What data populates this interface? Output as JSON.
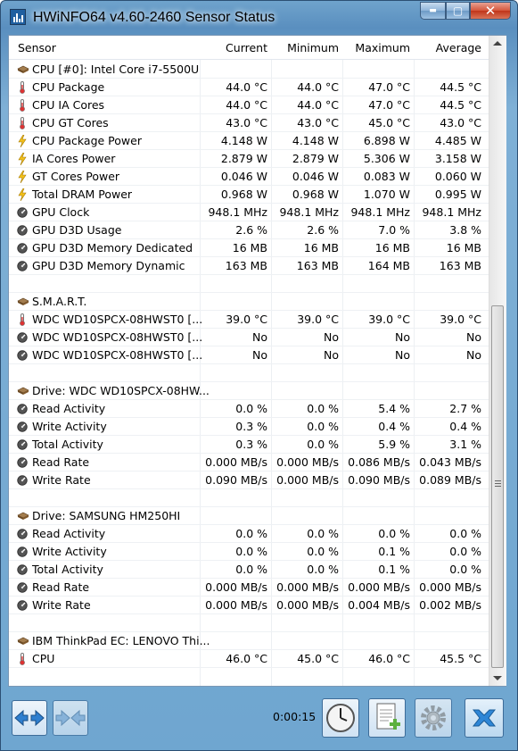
{
  "window": {
    "title": "HWiNFO64 v4.60-2460 Sensor Status",
    "close_glyph": "✕",
    "min_glyph": "▬",
    "max_glyph": "▢"
  },
  "columns": {
    "sensor": "Sensor",
    "current": "Current",
    "minimum": "Minimum",
    "maximum": "Maximum",
    "average": "Average"
  },
  "rows": [
    {
      "type": "group",
      "icon": "chip-icon",
      "label": "CPU [#0]: Intel Core i7-5500U"
    },
    {
      "type": "data",
      "icon": "thermometer-icon",
      "label": "CPU Package",
      "cur": "44.0 °C",
      "min": "44.0 °C",
      "max": "47.0 °C",
      "avg": "44.5 °C"
    },
    {
      "type": "data",
      "icon": "thermometer-icon",
      "label": "CPU IA Cores",
      "cur": "44.0 °C",
      "min": "44.0 °C",
      "max": "47.0 °C",
      "avg": "44.5 °C"
    },
    {
      "type": "data",
      "icon": "thermometer-icon",
      "label": "CPU GT Cores",
      "cur": "43.0 °C",
      "min": "43.0 °C",
      "max": "45.0 °C",
      "avg": "43.0 °C"
    },
    {
      "type": "data",
      "icon": "lightning-icon",
      "label": "CPU Package Power",
      "cur": "4.148 W",
      "min": "4.148 W",
      "max": "6.898 W",
      "avg": "4.485 W"
    },
    {
      "type": "data",
      "icon": "lightning-icon",
      "label": "IA Cores Power",
      "cur": "2.879 W",
      "min": "2.879 W",
      "max": "5.306 W",
      "avg": "3.158 W"
    },
    {
      "type": "data",
      "icon": "lightning-icon",
      "label": "GT Cores Power",
      "cur": "0.046 W",
      "min": "0.046 W",
      "max": "0.083 W",
      "avg": "0.060 W"
    },
    {
      "type": "data",
      "icon": "lightning-icon",
      "label": "Total DRAM Power",
      "cur": "0.968 W",
      "min": "0.968 W",
      "max": "1.070 W",
      "avg": "0.995 W"
    },
    {
      "type": "data",
      "icon": "gauge-icon",
      "label": "GPU Clock",
      "cur": "948.1 MHz",
      "min": "948.1 MHz",
      "max": "948.1 MHz",
      "avg": "948.1 MHz"
    },
    {
      "type": "data",
      "icon": "gauge-icon",
      "label": "GPU D3D Usage",
      "cur": "2.6 %",
      "min": "2.6 %",
      "max": "7.0 %",
      "avg": "3.8 %"
    },
    {
      "type": "data",
      "icon": "gauge-icon",
      "label": "GPU D3D Memory Dedicated",
      "cur": "16 MB",
      "min": "16 MB",
      "max": "16 MB",
      "avg": "16 MB"
    },
    {
      "type": "data",
      "icon": "gauge-icon",
      "label": "GPU D3D Memory Dynamic",
      "cur": "163 MB",
      "min": "163 MB",
      "max": "164 MB",
      "avg": "163 MB"
    },
    {
      "type": "blank"
    },
    {
      "type": "group",
      "icon": "chip-icon",
      "label": "S.M.A.R.T."
    },
    {
      "type": "data",
      "icon": "thermometer-icon",
      "label": "WDC WD10SPCX-08HWST0 [...",
      "cur": "39.0 °C",
      "min": "39.0 °C",
      "max": "39.0 °C",
      "avg": "39.0 °C"
    },
    {
      "type": "data",
      "icon": "gauge-icon",
      "label": "WDC WD10SPCX-08HWST0 [...",
      "cur": "No",
      "min": "No",
      "max": "No",
      "avg": "No"
    },
    {
      "type": "data",
      "icon": "gauge-icon",
      "label": "WDC WD10SPCX-08HWST0 [...",
      "cur": "No",
      "min": "No",
      "max": "No",
      "avg": "No"
    },
    {
      "type": "blank"
    },
    {
      "type": "group",
      "icon": "chip-icon",
      "label": "Drive: WDC WD10SPCX-08HW..."
    },
    {
      "type": "data",
      "icon": "gauge-icon",
      "label": "Read Activity",
      "cur": "0.0 %",
      "min": "0.0 %",
      "max": "5.4 %",
      "avg": "2.7 %"
    },
    {
      "type": "data",
      "icon": "gauge-icon",
      "label": "Write Activity",
      "cur": "0.3 %",
      "min": "0.0 %",
      "max": "0.4 %",
      "avg": "0.4 %"
    },
    {
      "type": "data",
      "icon": "gauge-icon",
      "label": "Total Activity",
      "cur": "0.3 %",
      "min": "0.0 %",
      "max": "5.9 %",
      "avg": "3.1 %"
    },
    {
      "type": "data",
      "icon": "gauge-icon",
      "label": "Read Rate",
      "cur": "0.000 MB/s",
      "min": "0.000 MB/s",
      "max": "0.086 MB/s",
      "avg": "0.043 MB/s"
    },
    {
      "type": "data",
      "icon": "gauge-icon",
      "label": "Write Rate",
      "cur": "0.090 MB/s",
      "min": "0.000 MB/s",
      "max": "0.090 MB/s",
      "avg": "0.089 MB/s"
    },
    {
      "type": "blank"
    },
    {
      "type": "group",
      "icon": "chip-icon",
      "label": "Drive: SAMSUNG HM250HI"
    },
    {
      "type": "data",
      "icon": "gauge-icon",
      "label": "Read Activity",
      "cur": "0.0 %",
      "min": "0.0 %",
      "max": "0.0 %",
      "avg": "0.0 %"
    },
    {
      "type": "data",
      "icon": "gauge-icon",
      "label": "Write Activity",
      "cur": "0.0 %",
      "min": "0.0 %",
      "max": "0.1 %",
      "avg": "0.0 %"
    },
    {
      "type": "data",
      "icon": "gauge-icon",
      "label": "Total Activity",
      "cur": "0.0 %",
      "min": "0.0 %",
      "max": "0.1 %",
      "avg": "0.0 %"
    },
    {
      "type": "data",
      "icon": "gauge-icon",
      "label": "Read Rate",
      "cur": "0.000 MB/s",
      "min": "0.000 MB/s",
      "max": "0.000 MB/s",
      "avg": "0.000 MB/s"
    },
    {
      "type": "data",
      "icon": "gauge-icon",
      "label": "Write Rate",
      "cur": "0.000 MB/s",
      "min": "0.000 MB/s",
      "max": "0.004 MB/s",
      "avg": "0.002 MB/s"
    },
    {
      "type": "blank"
    },
    {
      "type": "group",
      "icon": "chip-icon",
      "label": "IBM ThinkPad EC: LENOVO Thi..."
    },
    {
      "type": "data",
      "icon": "thermometer-icon",
      "label": "CPU",
      "cur": "46.0 °C",
      "min": "45.0 °C",
      "max": "46.0 °C",
      "avg": "45.5 °C"
    }
  ],
  "footer": {
    "timer": "0:00:15",
    "buttons": [
      "expand-arrows-icon",
      "collapse-arrows-icon",
      "clock-icon",
      "report-add-icon",
      "gear-icon",
      "close-x-icon"
    ]
  },
  "colors": {
    "accent": "#1f6fb5",
    "close": "#c0351a",
    "frame": "#6fa3cc"
  }
}
